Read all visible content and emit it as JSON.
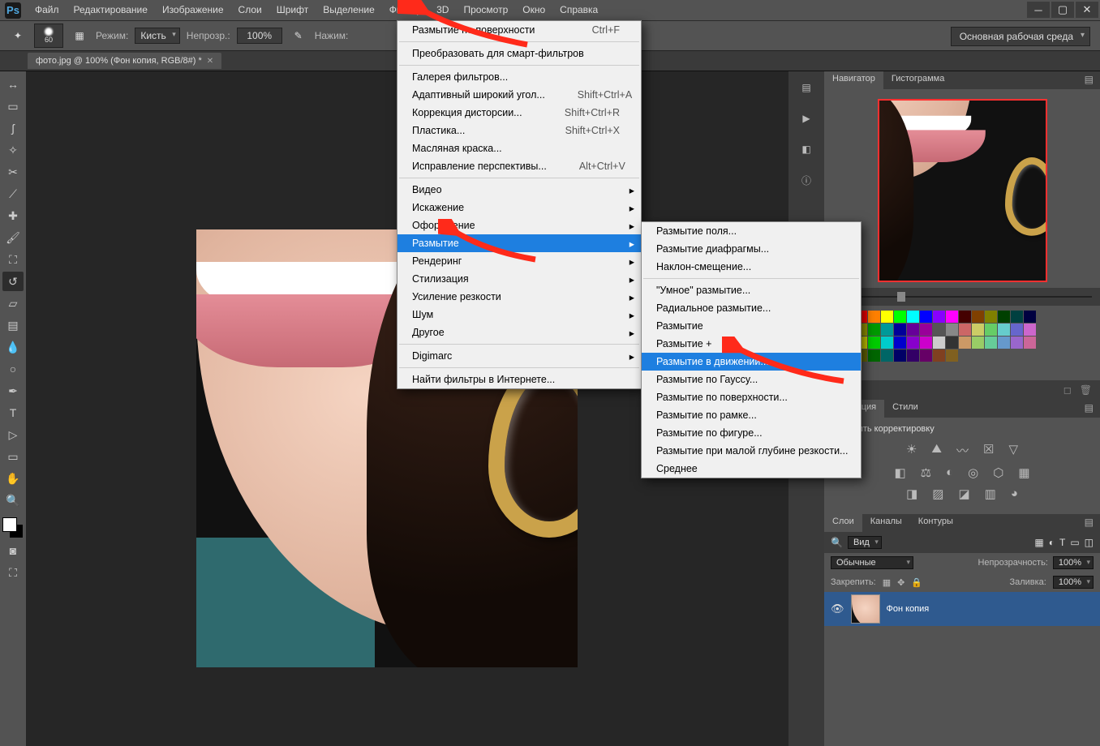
{
  "menu": {
    "items": [
      "Файл",
      "Редактирование",
      "Изображение",
      "Слои",
      "Шрифт",
      "Выделение",
      "Фильтр",
      "3D",
      "Просмотр",
      "Окно",
      "Справка"
    ]
  },
  "options": {
    "mode_label": "Режим:",
    "mode_value": "Кисть",
    "opacity_label": "Непрозр.:",
    "opacity_value": "100%",
    "flow_label": "Нажим:",
    "brush_size": "60"
  },
  "workspace": "Основная рабочая среда",
  "doc_tab": "фото.jpg @ 100% (Фон копия, RGB/8#) *",
  "filter_menu": [
    {
      "label": "Размытие по поверхности",
      "kb": "Ctrl+F"
    },
    {
      "sep": true
    },
    {
      "label": "Преобразовать для смарт-фильтров"
    },
    {
      "sep": true
    },
    {
      "label": "Галерея фильтров..."
    },
    {
      "label": "Адаптивный широкий угол...",
      "kb": "Shift+Ctrl+A"
    },
    {
      "label": "Коррекция дисторсии...",
      "kb": "Shift+Ctrl+R"
    },
    {
      "label": "Пластика...",
      "kb": "Shift+Ctrl+X"
    },
    {
      "label": "Масляная краска..."
    },
    {
      "label": "Исправление перспективы...",
      "kb": "Alt+Ctrl+V"
    },
    {
      "sep": true
    },
    {
      "label": "Видео",
      "sub": true
    },
    {
      "label": "Искажение",
      "sub": true
    },
    {
      "label": "Оформление",
      "sub": true
    },
    {
      "label": "Размытие",
      "sub": true,
      "hl": true
    },
    {
      "label": "Рендеринг",
      "sub": true
    },
    {
      "label": "Стилизация",
      "sub": true
    },
    {
      "label": "Усиление резкости",
      "sub": true
    },
    {
      "label": "Шум",
      "sub": true
    },
    {
      "label": "Другое",
      "sub": true
    },
    {
      "sep": true
    },
    {
      "label": "Digimarc",
      "sub": true
    },
    {
      "sep": true
    },
    {
      "label": "Найти фильтры в Интернете..."
    }
  ],
  "blur_menu": [
    {
      "label": "Размытие поля..."
    },
    {
      "label": "Размытие диафрагмы..."
    },
    {
      "label": "Наклон-смещение..."
    },
    {
      "sep": true
    },
    {
      "label": "\"Умное\" размытие..."
    },
    {
      "label": "Радиальное размытие..."
    },
    {
      "label": "Размытие"
    },
    {
      "label": "Размытие +"
    },
    {
      "label": "Размытие в движении...",
      "hl": true
    },
    {
      "label": "Размытие по Гауссу..."
    },
    {
      "label": "Размытие по поверхности..."
    },
    {
      "label": "Размытие по рамке..."
    },
    {
      "label": "Размытие по фигуре..."
    },
    {
      "label": "Размытие при малой глубине резкости..."
    },
    {
      "label": "Среднее"
    }
  ],
  "panels": {
    "navigator": "Навигатор",
    "histogram": "Гистограмма",
    "correction": "Коррекция",
    "styles": "Стили",
    "corr_title": "Добавить корректировку",
    "layers": "Слои",
    "channels": "Каналы",
    "paths": "Контуры",
    "kind": "Вид",
    "blend": "Обычные",
    "opacity_label": "Непрозрачность:",
    "opacity": "100%",
    "lock": "Закрепить:",
    "fill_label": "Заливка:",
    "fill": "100%",
    "layer_name": "Фон копия"
  },
  "swatch_colors": [
    "#fff",
    "#000",
    "#f00",
    "#ff8000",
    "#ff0",
    "#0f0",
    "#0ff",
    "#00f",
    "#80f",
    "#f0f",
    "#400",
    "#804000",
    "#808000",
    "#004000",
    "#004040",
    "#000040",
    "#900",
    "#c60",
    "#990",
    "#090",
    "#099",
    "#009",
    "#609",
    "#909",
    "#555",
    "#888",
    "#c66",
    "#cc6",
    "#6c6",
    "#6cc",
    "#66c",
    "#c6c",
    "#c00",
    "#f80",
    "#cc0",
    "#0c0",
    "#0cc",
    "#00c",
    "#80c",
    "#c0c",
    "#ccc",
    "#333",
    "#c96",
    "#9c6",
    "#6c9",
    "#69c",
    "#96c",
    "#c69",
    "#600",
    "#630",
    "#660",
    "#060",
    "#066",
    "#006",
    "#306",
    "#606",
    "#804020",
    "#806020"
  ]
}
